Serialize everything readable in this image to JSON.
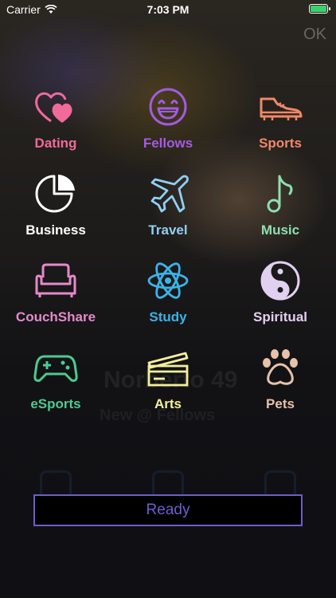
{
  "status_bar": {
    "carrier": "Carrier",
    "time": "7:03 PM"
  },
  "header": {
    "ok_label": "OK"
  },
  "categories": [
    {
      "label": "Dating",
      "icon": "hearts-icon",
      "color": "#f06a9a"
    },
    {
      "label": "Fellows",
      "icon": "laughing-face-icon",
      "color": "#a35be0"
    },
    {
      "label": "Sports",
      "icon": "sneaker-icon",
      "color": "#f08868"
    },
    {
      "label": "Business",
      "icon": "pie-chart-icon",
      "color": "#ffffff"
    },
    {
      "label": "Travel",
      "icon": "airplane-icon",
      "color": "#8fd0f5"
    },
    {
      "label": "Music",
      "icon": "music-note-icon",
      "color": "#8ce0b0"
    },
    {
      "label": "CouchShare",
      "icon": "couch-icon",
      "color": "#e58acb"
    },
    {
      "label": "Study",
      "icon": "atom-icon",
      "color": "#3ab3e8"
    },
    {
      "label": "Spiritual",
      "icon": "yin-yang-icon",
      "color": "#e2d0f0"
    },
    {
      "label": "eSports",
      "icon": "gamepad-icon",
      "color": "#4ccb91"
    },
    {
      "label": "Arts",
      "icon": "ticket-icon",
      "color": "#f4ef9a"
    },
    {
      "label": "Pets",
      "icon": "paw-icon",
      "color": "#e8c2a8"
    }
  ],
  "background": {
    "name": "Norberto 49",
    "subtitle": "New @ Fellows"
  },
  "ready_button": {
    "label": "Ready"
  }
}
